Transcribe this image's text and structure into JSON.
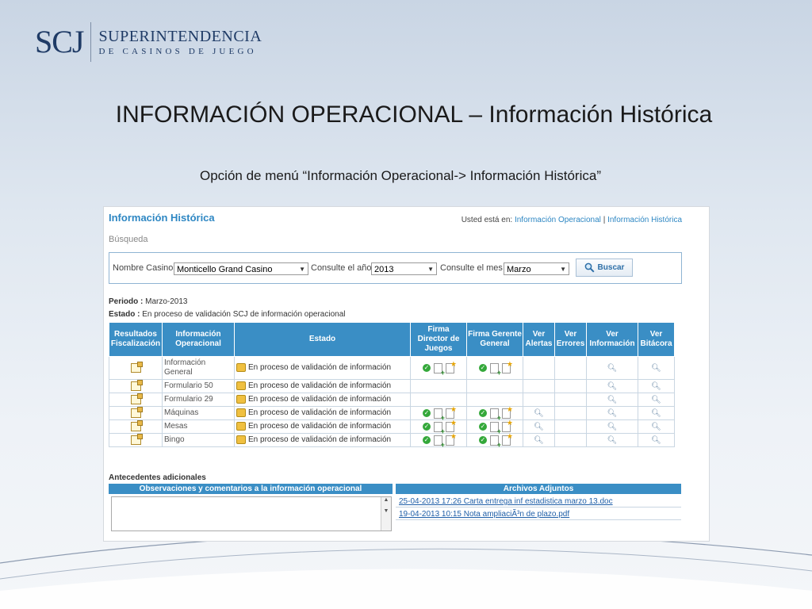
{
  "logo": {
    "mark": "SCJ",
    "line1": "SUPERINTENDENCIA",
    "line2": "DE CASINOS DE JUEGO"
  },
  "slide": {
    "title": "INFORMACIÓN OPERACIONAL – Información Histórica",
    "subtitle": "Opción de menú “Información Operacional-> Información Histórica”"
  },
  "page": {
    "title": "Información Histórica",
    "breadcrumb_prefix": "Usted está en:",
    "breadcrumb_link1": "Información Operacional",
    "breadcrumb_sep": "|",
    "breadcrumb_link2": "Información Histórica",
    "search_label": "Búsqueda"
  },
  "search": {
    "casino_label": "Nombre Casino",
    "casino_value": "Monticello Grand Casino",
    "year_label": "Consulte el año",
    "year_value": "2013",
    "month_label": "Consulte el mes",
    "month_value": "Marzo",
    "button_label": "Buscar"
  },
  "meta": {
    "periodo_label": "Periodo :",
    "periodo_value": "Marzo-2013",
    "estado_label": "Estado :",
    "estado_value": "En proceso de validación SCJ de información operacional"
  },
  "table": {
    "headers": [
      "Resultados Fiscalización",
      "Información Operacional",
      "Estado",
      "Firma Director de Juegos",
      "Firma Gerente General",
      "Ver Alertas",
      "Ver Errores",
      "Ver Información",
      "Ver Bitácora"
    ],
    "rows": [
      {
        "info": "Información General",
        "estado": "En proceso de validación de información",
        "firma_director": true,
        "firma_gerente": true,
        "alertas": false,
        "errores": false,
        "informacion": true,
        "bitacora": true
      },
      {
        "info": "Formulario 50",
        "estado": "En proceso de validación de información",
        "firma_director": false,
        "firma_gerente": false,
        "alertas": false,
        "errores": false,
        "informacion": true,
        "bitacora": true
      },
      {
        "info": "Formulario 29",
        "estado": "En proceso de validación de información",
        "firma_director": false,
        "firma_gerente": false,
        "alertas": false,
        "errores": false,
        "informacion": true,
        "bitacora": true
      },
      {
        "info": "Máquinas",
        "estado": "En proceso de validación de información",
        "firma_director": true,
        "firma_gerente": true,
        "alertas": true,
        "errores": false,
        "informacion": true,
        "bitacora": true
      },
      {
        "info": "Mesas",
        "estado": "En proceso de validación de información",
        "firma_director": true,
        "firma_gerente": true,
        "alertas": true,
        "errores": false,
        "informacion": true,
        "bitacora": true
      },
      {
        "info": "Bingo",
        "estado": "En proceso de validación de información",
        "firma_director": true,
        "firma_gerente": true,
        "alertas": true,
        "errores": false,
        "informacion": true,
        "bitacora": true
      }
    ]
  },
  "antecedentes": {
    "title": "Antecedentes adicionales",
    "obs_header": "Observaciones y comentarios a la información operacional",
    "obs_value": "",
    "files_header": "Archivos Adjuntos",
    "files": [
      "25-04-2013 17:26 Carta entrega inf estadistica marzo 13.doc",
      "19-04-2013 10:15 Nota ampliaciÃ³n de plazo.pdf"
    ]
  },
  "icons": {
    "result": "document-edit-icon",
    "estado": "hand-icon",
    "firma": "check-circle-icon",
    "view": "magnifier-icon"
  },
  "colors": {
    "header_blue": "#3a8ec5",
    "title_blue": "#2e87c3",
    "link_blue": "#1f5fa8",
    "logo_navy": "#1f3b66"
  }
}
